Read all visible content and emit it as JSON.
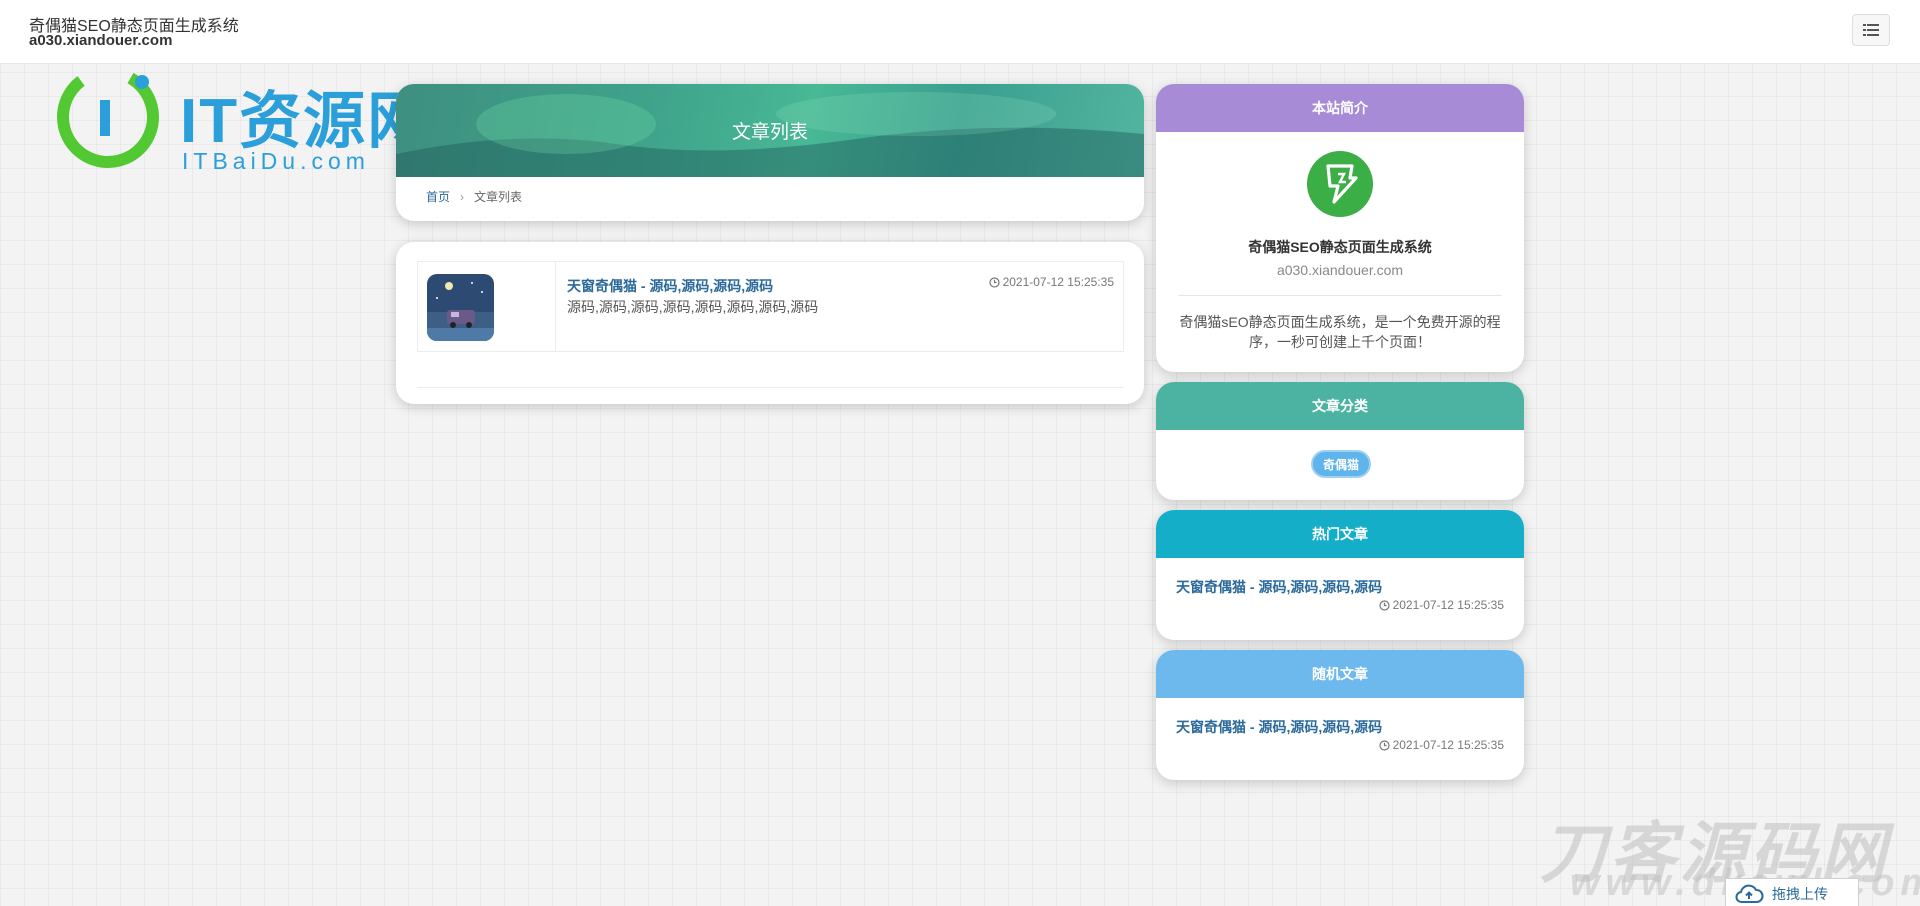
{
  "header": {
    "site_name": "奇偶猫SEO静态页面生成系统",
    "site_domain": "a030.xiandouer.com",
    "menu_icon": "list-icon"
  },
  "watermark_logo": {
    "main": "IT资源网",
    "sub": "ITBaiDu.com"
  },
  "main": {
    "banner_title": "文章列表",
    "breadcrumb": {
      "home": "首页",
      "separator": "›",
      "current": "文章列表"
    },
    "articles": [
      {
        "title": "天窗奇偶猫 - 源码,源码,源码,源码",
        "summary": "源码,源码,源码,源码,源码,源码,源码,源码",
        "date": "2021-07-12 15:25:35",
        "thumbnail_icon": "night-sky-car-thumbnail"
      }
    ]
  },
  "sidebar": {
    "intro": {
      "heading": "本站简介",
      "title": "奇偶猫SEO静态页面生成系统",
      "domain": "a030.xiandouer.com",
      "description": "奇偶猫sEO静态页面生成系统，是一个免费开源的程序，一秒可创建上千个页面！"
    },
    "categories": {
      "heading": "文章分类",
      "items": [
        "奇偶猫"
      ]
    },
    "hot": {
      "heading": "热门文章",
      "items": [
        {
          "title": "天窗奇偶猫 - 源码,源码,源码,源码",
          "date": "2021-07-12 15:25:35"
        }
      ]
    },
    "random": {
      "heading": "随机文章",
      "items": [
        {
          "title": "天窗奇偶猫 - 源码,源码,源码,源码",
          "date": "2021-07-12 15:25:35"
        }
      ]
    }
  },
  "corner_watermark": {
    "text": "刀客源码网",
    "url": "www.dkewl.com",
    "upload_label": "拖拽上传"
  },
  "colors": {
    "intro_head": "#a88bd6",
    "category_head": "#4cb3a3",
    "hot_head": "#14aec9",
    "random_head": "#6db8ec",
    "link": "#2b6a9a",
    "banner": "#3fa48b"
  }
}
